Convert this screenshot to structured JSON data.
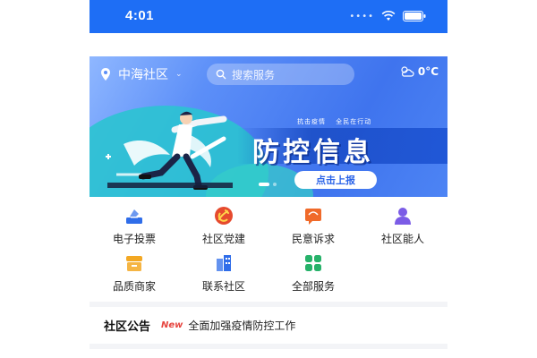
{
  "status_bar": {
    "time": "4:01",
    "background": "#1e6ef5"
  },
  "banner": {
    "location": "中海社区",
    "search_placeholder": "搜索服务",
    "weather": "0°C",
    "slogan_left": "抗击疫情",
    "slogan_right": "全民在行动",
    "title": "防控信息",
    "report_button": "点击上报",
    "pager": {
      "count": 2,
      "active_index": 0
    }
  },
  "services": [
    {
      "label": "电子投票",
      "icon": "vote-icon",
      "color": "#2f6de9"
    },
    {
      "label": "社区党建",
      "icon": "party-icon",
      "color": "#e64a2e"
    },
    {
      "label": "民意诉求",
      "icon": "feedback-icon",
      "color": "#f06a2a"
    },
    {
      "label": "社区能人",
      "icon": "person-icon",
      "color": "#7b5ce6"
    },
    {
      "label": "品质商家",
      "icon": "shop-icon",
      "color": "#f3a823"
    },
    {
      "label": "联系社区",
      "icon": "building-icon",
      "color": "#2f6de9"
    },
    {
      "label": "全部服务",
      "icon": "all-services-icon",
      "color": "#27b26a"
    }
  ],
  "notice": {
    "brand": "社区公告",
    "badge": "New",
    "text": "全面加强疫情防控工作"
  }
}
